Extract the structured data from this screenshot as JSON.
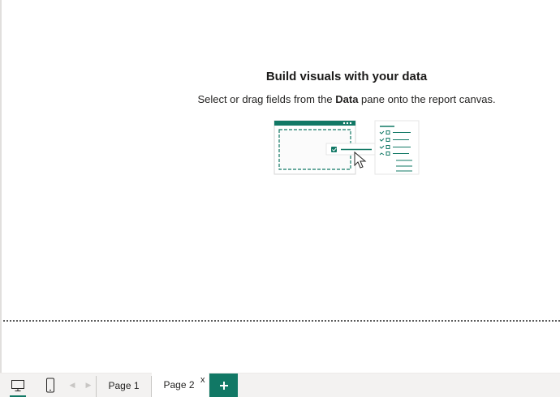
{
  "empty_state": {
    "title": "Build visuals with your data",
    "subtitle_before": "Select or drag fields from the ",
    "subtitle_bold": "Data",
    "subtitle_after": " pane onto the report canvas."
  },
  "tab_bar": {
    "desktop_view_icon": "monitor-icon",
    "mobile_view_icon": "phone-icon",
    "prev_icon": "chevron-left-icon",
    "next_icon": "chevron-right-icon",
    "pages": [
      {
        "label": "Page 1",
        "active": false
      },
      {
        "label": "Page 2",
        "active": true
      }
    ],
    "close_label": "x",
    "add_icon": "plus-icon"
  },
  "colors": {
    "accent": "#117865",
    "tab_bar_bg": "#f3f2f1",
    "boundary": "#5a5a5a"
  }
}
